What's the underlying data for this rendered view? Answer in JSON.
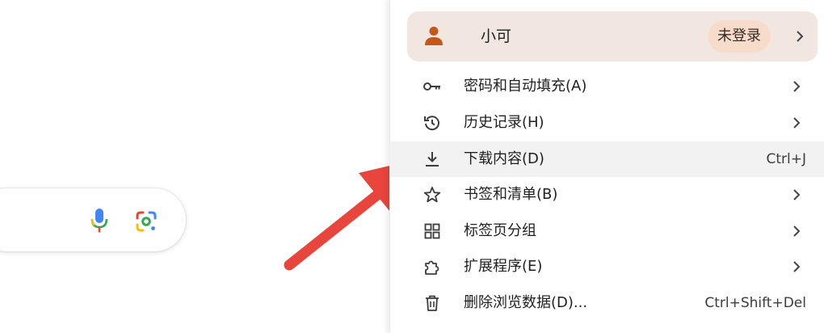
{
  "search": {
    "mic_icon": "microphone-icon",
    "lens_icon": "google-lens-icon"
  },
  "menu": {
    "profile": {
      "name": "小可",
      "status": "未登录",
      "icon": "person-icon"
    },
    "items": [
      {
        "label": "密码和自动填充(A)",
        "icon": "key-icon",
        "shortcut": "",
        "submenu": true
      },
      {
        "label": "历史记录(H)",
        "icon": "history-icon",
        "shortcut": "",
        "submenu": true
      },
      {
        "label": "下载内容(D)",
        "icon": "download-icon",
        "shortcut": "Ctrl+J",
        "submenu": false
      },
      {
        "label": "书签和清单(B)",
        "icon": "star-icon",
        "shortcut": "",
        "submenu": true
      },
      {
        "label": "标签页分组",
        "icon": "grid-icon",
        "shortcut": "",
        "submenu": true
      },
      {
        "label": "扩展程序(E)",
        "icon": "puzzle-icon",
        "shortcut": "",
        "submenu": true
      },
      {
        "label": "删除浏览数据(D)...",
        "icon": "trash-icon",
        "shortcut": "Ctrl+Shift+Del",
        "submenu": false
      }
    ]
  },
  "colors": {
    "profile_bg": "#f2e6e0",
    "badge_bg": "#f8dccb",
    "person_icon": "#c5561a",
    "highlight_bg": "#f2f2f2",
    "arrow": "#e8453c"
  }
}
